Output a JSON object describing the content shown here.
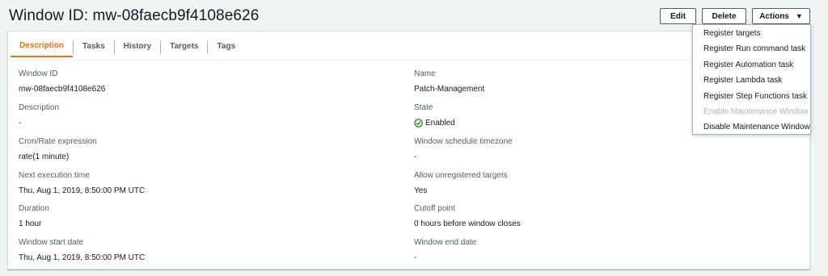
{
  "header": {
    "title": "Window ID: mw-08faecb9f4108e626",
    "edit_label": "Edit",
    "delete_label": "Delete",
    "actions_label": "Actions",
    "actions_caret": "▼"
  },
  "tabs": [
    {
      "label": "Description",
      "active": true
    },
    {
      "label": "Tasks",
      "active": false
    },
    {
      "label": "History",
      "active": false
    },
    {
      "label": "Targets",
      "active": false
    },
    {
      "label": "Tags",
      "active": false
    }
  ],
  "details": {
    "window_id": {
      "label": "Window ID",
      "value": "mw-08faecb9f4108e626"
    },
    "description": {
      "label": "Description",
      "value": "-"
    },
    "cron": {
      "label": "Cron/Rate expression",
      "value": "rate(1 minute)"
    },
    "next_execution": {
      "label": "Next execution time",
      "value": "Thu, Aug 1, 2019, 8:50:00 PM UTC"
    },
    "duration": {
      "label": "Duration",
      "value": "1 hour"
    },
    "start_date": {
      "label": "Window start date",
      "value": "Thu, Aug 1, 2019, 8:50:00 PM UTC"
    },
    "name": {
      "label": "Name",
      "value": "Patch-Management"
    },
    "state": {
      "label": "State",
      "value": "Enabled"
    },
    "timezone": {
      "label": "Window schedule timezone",
      "value": "-"
    },
    "unregistered": {
      "label": "Allow unregistered targets",
      "value": "Yes"
    },
    "cutoff": {
      "label": "Cutoff point",
      "value": "0 hours before window closes"
    },
    "end_date": {
      "label": "Window end date",
      "value": "-"
    }
  },
  "actions_menu": [
    {
      "label": "Register targets",
      "disabled": false
    },
    {
      "label": "Register Run command task",
      "disabled": false
    },
    {
      "label": "Register Automation task",
      "disabled": false
    },
    {
      "label": "Register Lambda task",
      "disabled": false
    },
    {
      "label": "Register Step Functions task",
      "disabled": false
    },
    {
      "label": "Enable Maintenance Window",
      "disabled": true
    },
    {
      "label": "Disable Maintenance Window",
      "disabled": false
    }
  ],
  "colors": {
    "accent": "#ec7211",
    "success": "#1d8102",
    "disabled_text": "#aab7b8"
  }
}
